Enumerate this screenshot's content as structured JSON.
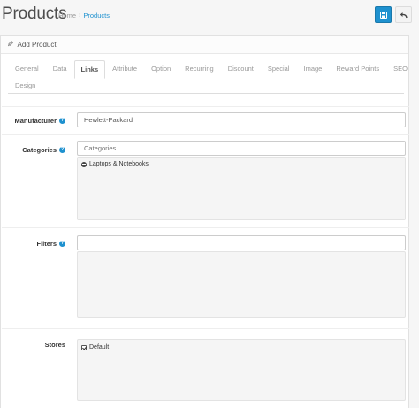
{
  "header": {
    "title": "Products",
    "breadcrumb": {
      "home": "Home",
      "separator": "›",
      "current": "Products"
    },
    "save_icon": "save-icon",
    "back_icon": "reply-icon"
  },
  "panel": {
    "heading": "Add Product",
    "heading_icon": "pencil-icon"
  },
  "tabs": [
    {
      "label": "General",
      "active": false
    },
    {
      "label": "Data",
      "active": false
    },
    {
      "label": "Links",
      "active": true
    },
    {
      "label": "Attribute",
      "active": false
    },
    {
      "label": "Option",
      "active": false
    },
    {
      "label": "Recurring",
      "active": false
    },
    {
      "label": "Discount",
      "active": false
    },
    {
      "label": "Special",
      "active": false
    },
    {
      "label": "Image",
      "active": false
    },
    {
      "label": "Reward Points",
      "active": false
    },
    {
      "label": "SEO",
      "active": false
    },
    {
      "label": "Design",
      "active": false
    }
  ],
  "form": {
    "manufacturer": {
      "label": "Manufacturer",
      "value": "Hewlett-Packard"
    },
    "categories": {
      "label": "Categories",
      "placeholder": "Categories",
      "selected": [
        "Laptops & Notebooks"
      ]
    },
    "filters": {
      "label": "Filters",
      "value": ""
    },
    "stores": {
      "label": "Stores",
      "options": [
        {
          "label": "Default",
          "checked": true
        }
      ]
    }
  },
  "colors": {
    "primary": "#1e91cf",
    "help": "#1e91cf"
  }
}
